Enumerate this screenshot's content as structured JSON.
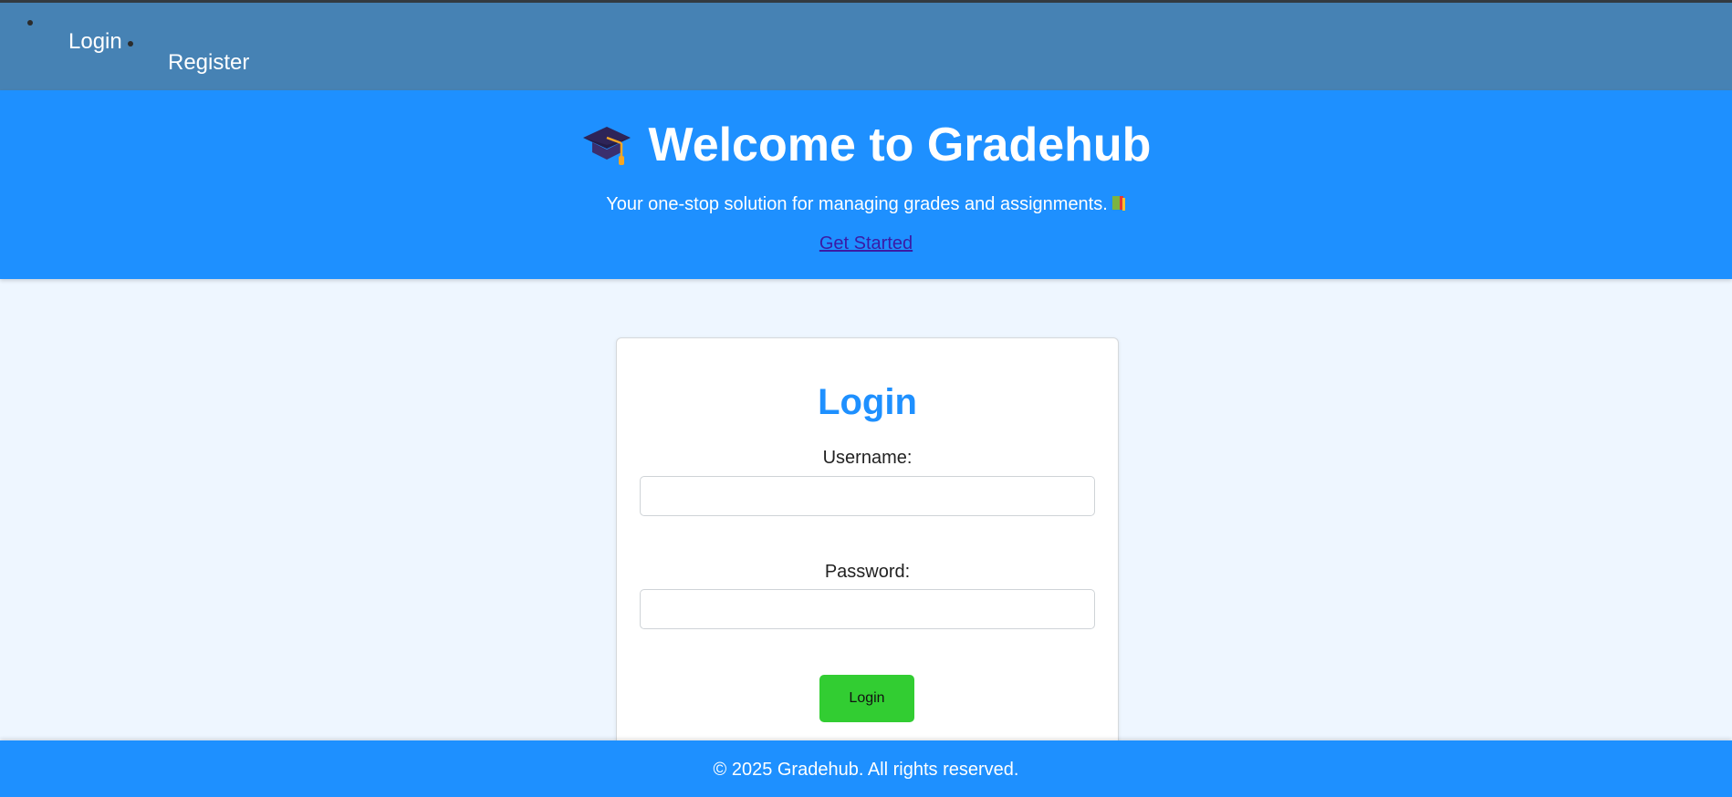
{
  "nav": {
    "links": [
      {
        "label": "Login"
      },
      {
        "label": "Register"
      }
    ]
  },
  "hero": {
    "title": "Welcome to Gradehub",
    "title_icon": "graduation-cap-icon",
    "subtitle": "Your one-stop solution for managing grades and assignments.",
    "subtitle_icon": "book-icon",
    "cta_label": "Get Started"
  },
  "login_form": {
    "title": "Login",
    "username_label": "Username:",
    "username_value": "",
    "password_label": "Password:",
    "password_value": "",
    "submit_label": "Login"
  },
  "footer": {
    "text": "© 2025 Gradehub. All rights reserved."
  },
  "colors": {
    "nav_bg": "#4682b4",
    "hero_bg": "#1e90ff",
    "page_bg": "#eef6ff",
    "accent": "#1e90ff",
    "button": "#32cd32",
    "link": "#3a1ba6"
  }
}
